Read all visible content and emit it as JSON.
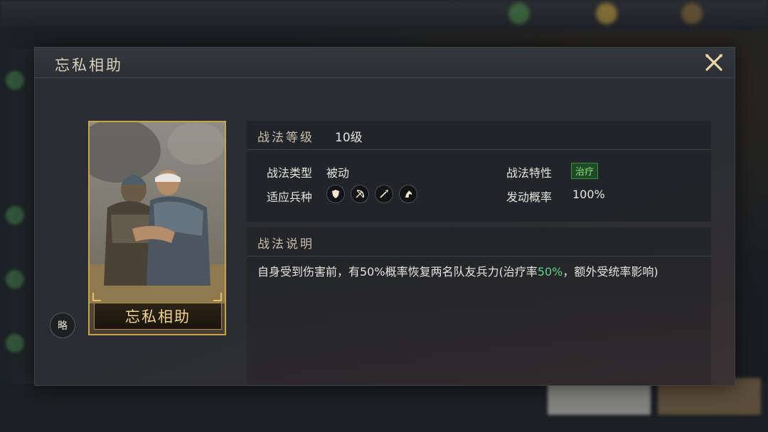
{
  "dialog": {
    "title": "忘私相助"
  },
  "card": {
    "name": "忘私相助",
    "strategy_badge": "略"
  },
  "info": {
    "level_label": "战法等级",
    "level_value": "10级",
    "type_label": "战法类型",
    "type_value": "被动",
    "trait_label": "战法特性",
    "trait_value": "治疗",
    "troops_label": "适应兵种",
    "troops": [
      "shield-icon",
      "bow-icon",
      "spear-icon",
      "horse-icon"
    ],
    "rate_label": "发动概率",
    "rate_value": "100%"
  },
  "description": {
    "label": "战法说明",
    "text_before": "自身受到伤害前，有50%概率恢复两名队友兵力(治疗率",
    "highlight": "50%",
    "text_after": "，额外受统率影响)"
  },
  "colors": {
    "accent_gold": "#c9a24a",
    "heal_green": "#5fd38a"
  }
}
